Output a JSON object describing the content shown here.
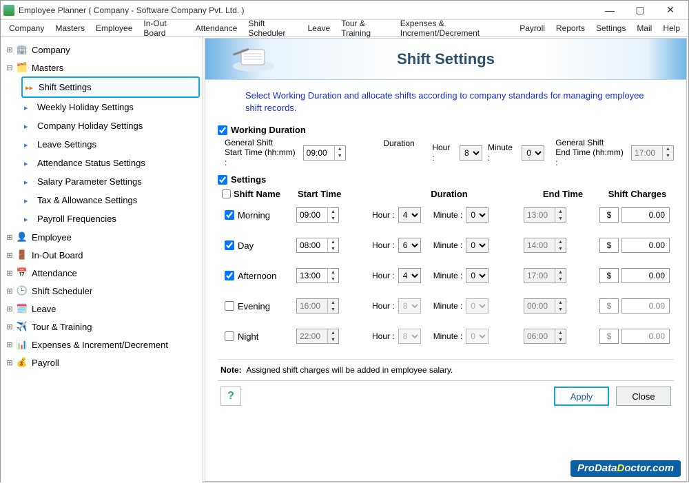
{
  "window": {
    "title": "Employee Planner ( Company - Software Company Pvt. Ltd. )"
  },
  "menu": [
    "Company",
    "Masters",
    "Employee",
    "In-Out Board",
    "Attendance",
    "Shift Scheduler",
    "Leave",
    "Tour & Training",
    "Expenses & Increment/Decrement",
    "Payroll",
    "Reports",
    "Settings",
    "Mail",
    "Help"
  ],
  "tree": {
    "company": "Company",
    "masters": "Masters",
    "masters_children": [
      "Shift Settings",
      "Weekly Holiday Settings",
      "Company Holiday Settings",
      "Leave Settings",
      "Attendance Status Settings",
      "Salary Parameter Settings",
      "Tax & Allowance Settings",
      "Payroll Frequencies"
    ],
    "employee": "Employee",
    "inout": "In-Out Board",
    "attendance": "Attendance",
    "shift_scheduler": "Shift Scheduler",
    "leave": "Leave",
    "tour": "Tour & Training",
    "expenses": "Expenses & Increment/Decrement",
    "payroll": "Payroll"
  },
  "header": {
    "title": "Shift Settings"
  },
  "intro": "Select Working Duration and allocate shifts according to company standards for managing employee shift records.",
  "labels": {
    "working_duration": "Working Duration",
    "general_start": "General Shift\nStart Time (hh:mm) :",
    "duration": "Duration",
    "hour": "Hour :",
    "minute": "Minute :",
    "general_end": "General Shift\nEnd Time (hh:mm) :",
    "settings": "Settings",
    "shift_name": "Shift Name",
    "start_time": "Start Time",
    "duration_col": "Duration",
    "end_time": "End Time",
    "shift_charges": "Shift Charges",
    "note_label": "Note:",
    "note_text": "Assigned shift charges will be added in employee salary.",
    "apply": "Apply",
    "close": "Close",
    "currency": "$"
  },
  "working_duration": {
    "start": "09:00",
    "hour": "8",
    "minute": "0",
    "end": "17:00"
  },
  "shifts": [
    {
      "name": "Morning",
      "enabled": true,
      "start": "09:00",
      "hour": "4",
      "minute": "0",
      "end": "13:00",
      "charge": "0.00"
    },
    {
      "name": "Day",
      "enabled": true,
      "start": "08:00",
      "hour": "6",
      "minute": "0",
      "end": "14:00",
      "charge": "0.00"
    },
    {
      "name": "Afternoon",
      "enabled": true,
      "start": "13:00",
      "hour": "4",
      "minute": "0",
      "end": "17:00",
      "charge": "0.00"
    },
    {
      "name": "Evening",
      "enabled": false,
      "start": "16:00",
      "hour": "8",
      "minute": "0",
      "end": "00:00",
      "charge": "0.00"
    },
    {
      "name": "Night",
      "enabled": false,
      "start": "22:00",
      "hour": "8",
      "minute": "0",
      "end": "06:00",
      "charge": "0.00"
    }
  ],
  "watermark": "ProDataDoctor.com"
}
